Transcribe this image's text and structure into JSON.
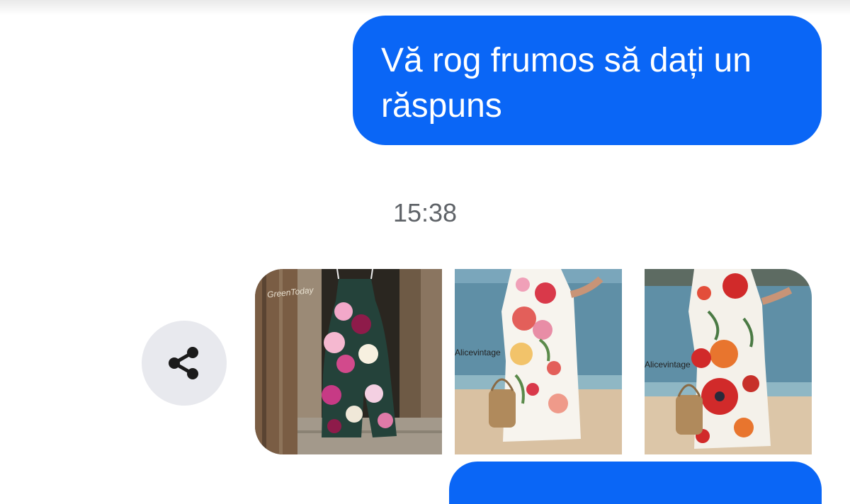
{
  "messages": [
    {
      "direction": "outgoing",
      "text": "Vă rog frumos să dați un răspuns"
    }
  ],
  "timestamp": "15:38",
  "share_icon": "share-icon",
  "product_images": [
    {
      "description_icon": "floral-jumpsuit-photo",
      "watermark": "GreenToday"
    },
    {
      "description_icon": "floral-beach-dress-photo",
      "watermark": "Alicevintage"
    },
    {
      "description_icon": "poppy-beach-dress-photo",
      "watermark": "Alicevintage"
    }
  ],
  "colors": {
    "bubble": "#0a66f6",
    "timestamp": "#5f6368",
    "share_bg": "#e8e9ee"
  }
}
